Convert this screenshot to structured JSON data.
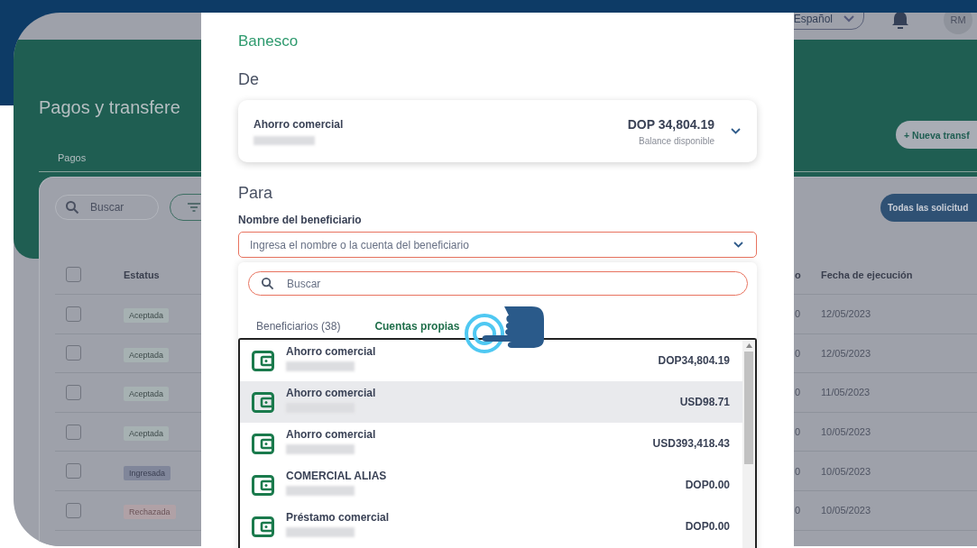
{
  "header": {
    "language": "Español",
    "avatar": "RM"
  },
  "page": {
    "title": "Pagos y transfere",
    "tab": "Pagos",
    "new_button": "+ Nueva transf"
  },
  "toolbar": {
    "search_placeholder": "Buscar",
    "filter_button": "Todas las solicitud"
  },
  "table": {
    "columns": [
      "Estatus",
      "o",
      "Fecha de ejecución"
    ],
    "header_checked": false,
    "rows": [
      {
        "checked": false,
        "status": "Aceptada",
        "kind": "accepted",
        "column_3": "0",
        "date": "12/05/2023"
      },
      {
        "checked": false,
        "status": "Aceptada",
        "kind": "accepted",
        "column_3": "0",
        "date": "12/05/2023"
      },
      {
        "checked": false,
        "status": "Aceptada",
        "kind": "accepted",
        "column_3": "0",
        "date": "11/05/2023"
      },
      {
        "checked": false,
        "status": "Aceptada",
        "kind": "accepted",
        "column_3": "0",
        "date": "10/05/2023"
      },
      {
        "checked": false,
        "status": "Ingresada",
        "kind": "entered",
        "column_3": "0",
        "date": "10/05/2023"
      },
      {
        "checked": false,
        "status": "Rechazada",
        "kind": "rejected",
        "column_3": "0",
        "date": "10/05/2023"
      }
    ]
  },
  "modal": {
    "bank": "Banesco",
    "from_heading": "De",
    "from_account": {
      "name": "Ahorro comercial",
      "balance": "DOP 34,804.19",
      "balance_label": "Balance disponible"
    },
    "to_heading": "Para",
    "beneficiary_label": "Nombre del beneficiario",
    "beneficiary_placeholder": "Ingresa el nombre o la cuenta del beneficiario",
    "dropdown": {
      "search_placeholder": "Buscar",
      "tabs": [
        {
          "label": "Beneficiarios (38)",
          "selected": false
        },
        {
          "label": "Cuentas propias",
          "selected": true
        }
      ],
      "accounts": [
        {
          "name": "Ahorro comercial",
          "amount": "DOP34,804.19",
          "selected": false
        },
        {
          "name": "Ahorro comercial",
          "amount": "USD98.71",
          "selected": true
        },
        {
          "name": "Ahorro comercial",
          "amount": "USD393,418.43",
          "selected": false
        },
        {
          "name": "COMERCIAL ALIAS",
          "amount": "DOP0.00",
          "selected": false
        },
        {
          "name": "Préstamo comercial",
          "amount": "DOP0.00",
          "selected": false
        }
      ]
    }
  }
}
